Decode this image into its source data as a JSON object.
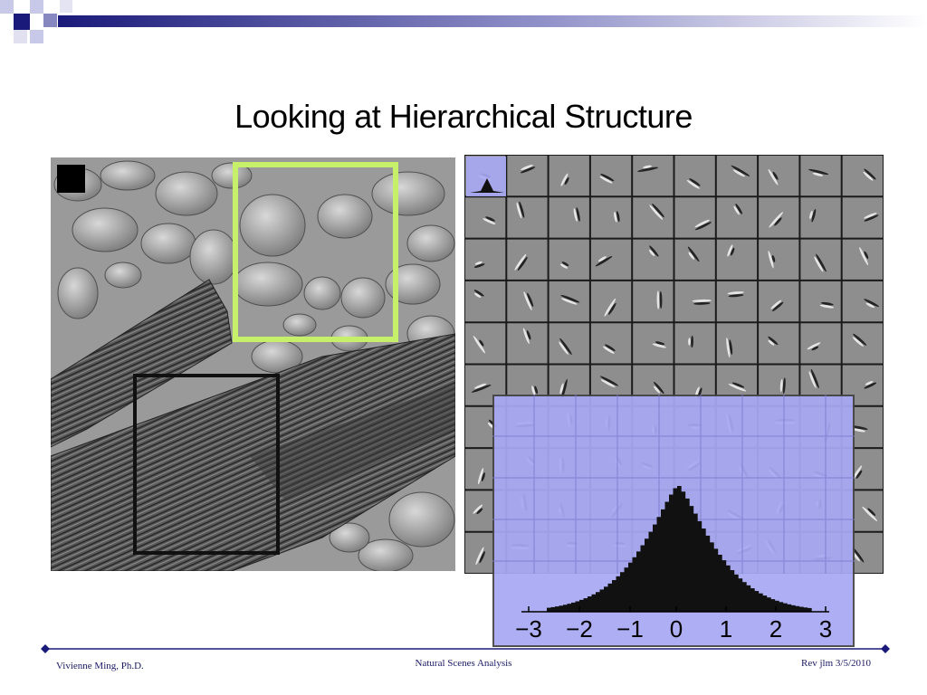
{
  "slide": {
    "title": "Looking at Hierarchical Structure"
  },
  "histogram": {
    "tick_labels": [
      "−3",
      "−2",
      "−1",
      "0",
      "1",
      "2",
      "3"
    ],
    "bar_color": "#111111",
    "panel_color": "#a8a8f4"
  },
  "footer": {
    "author": "Vivienne Ming, Ph.D.",
    "topic": "Natural Scenes Analysis",
    "revision": "Rev jlm 3/5/2010"
  },
  "colors": {
    "accent_navy": "#1a1a7a",
    "highlight_green": "#c6f06a",
    "box_black": "#111111"
  }
}
